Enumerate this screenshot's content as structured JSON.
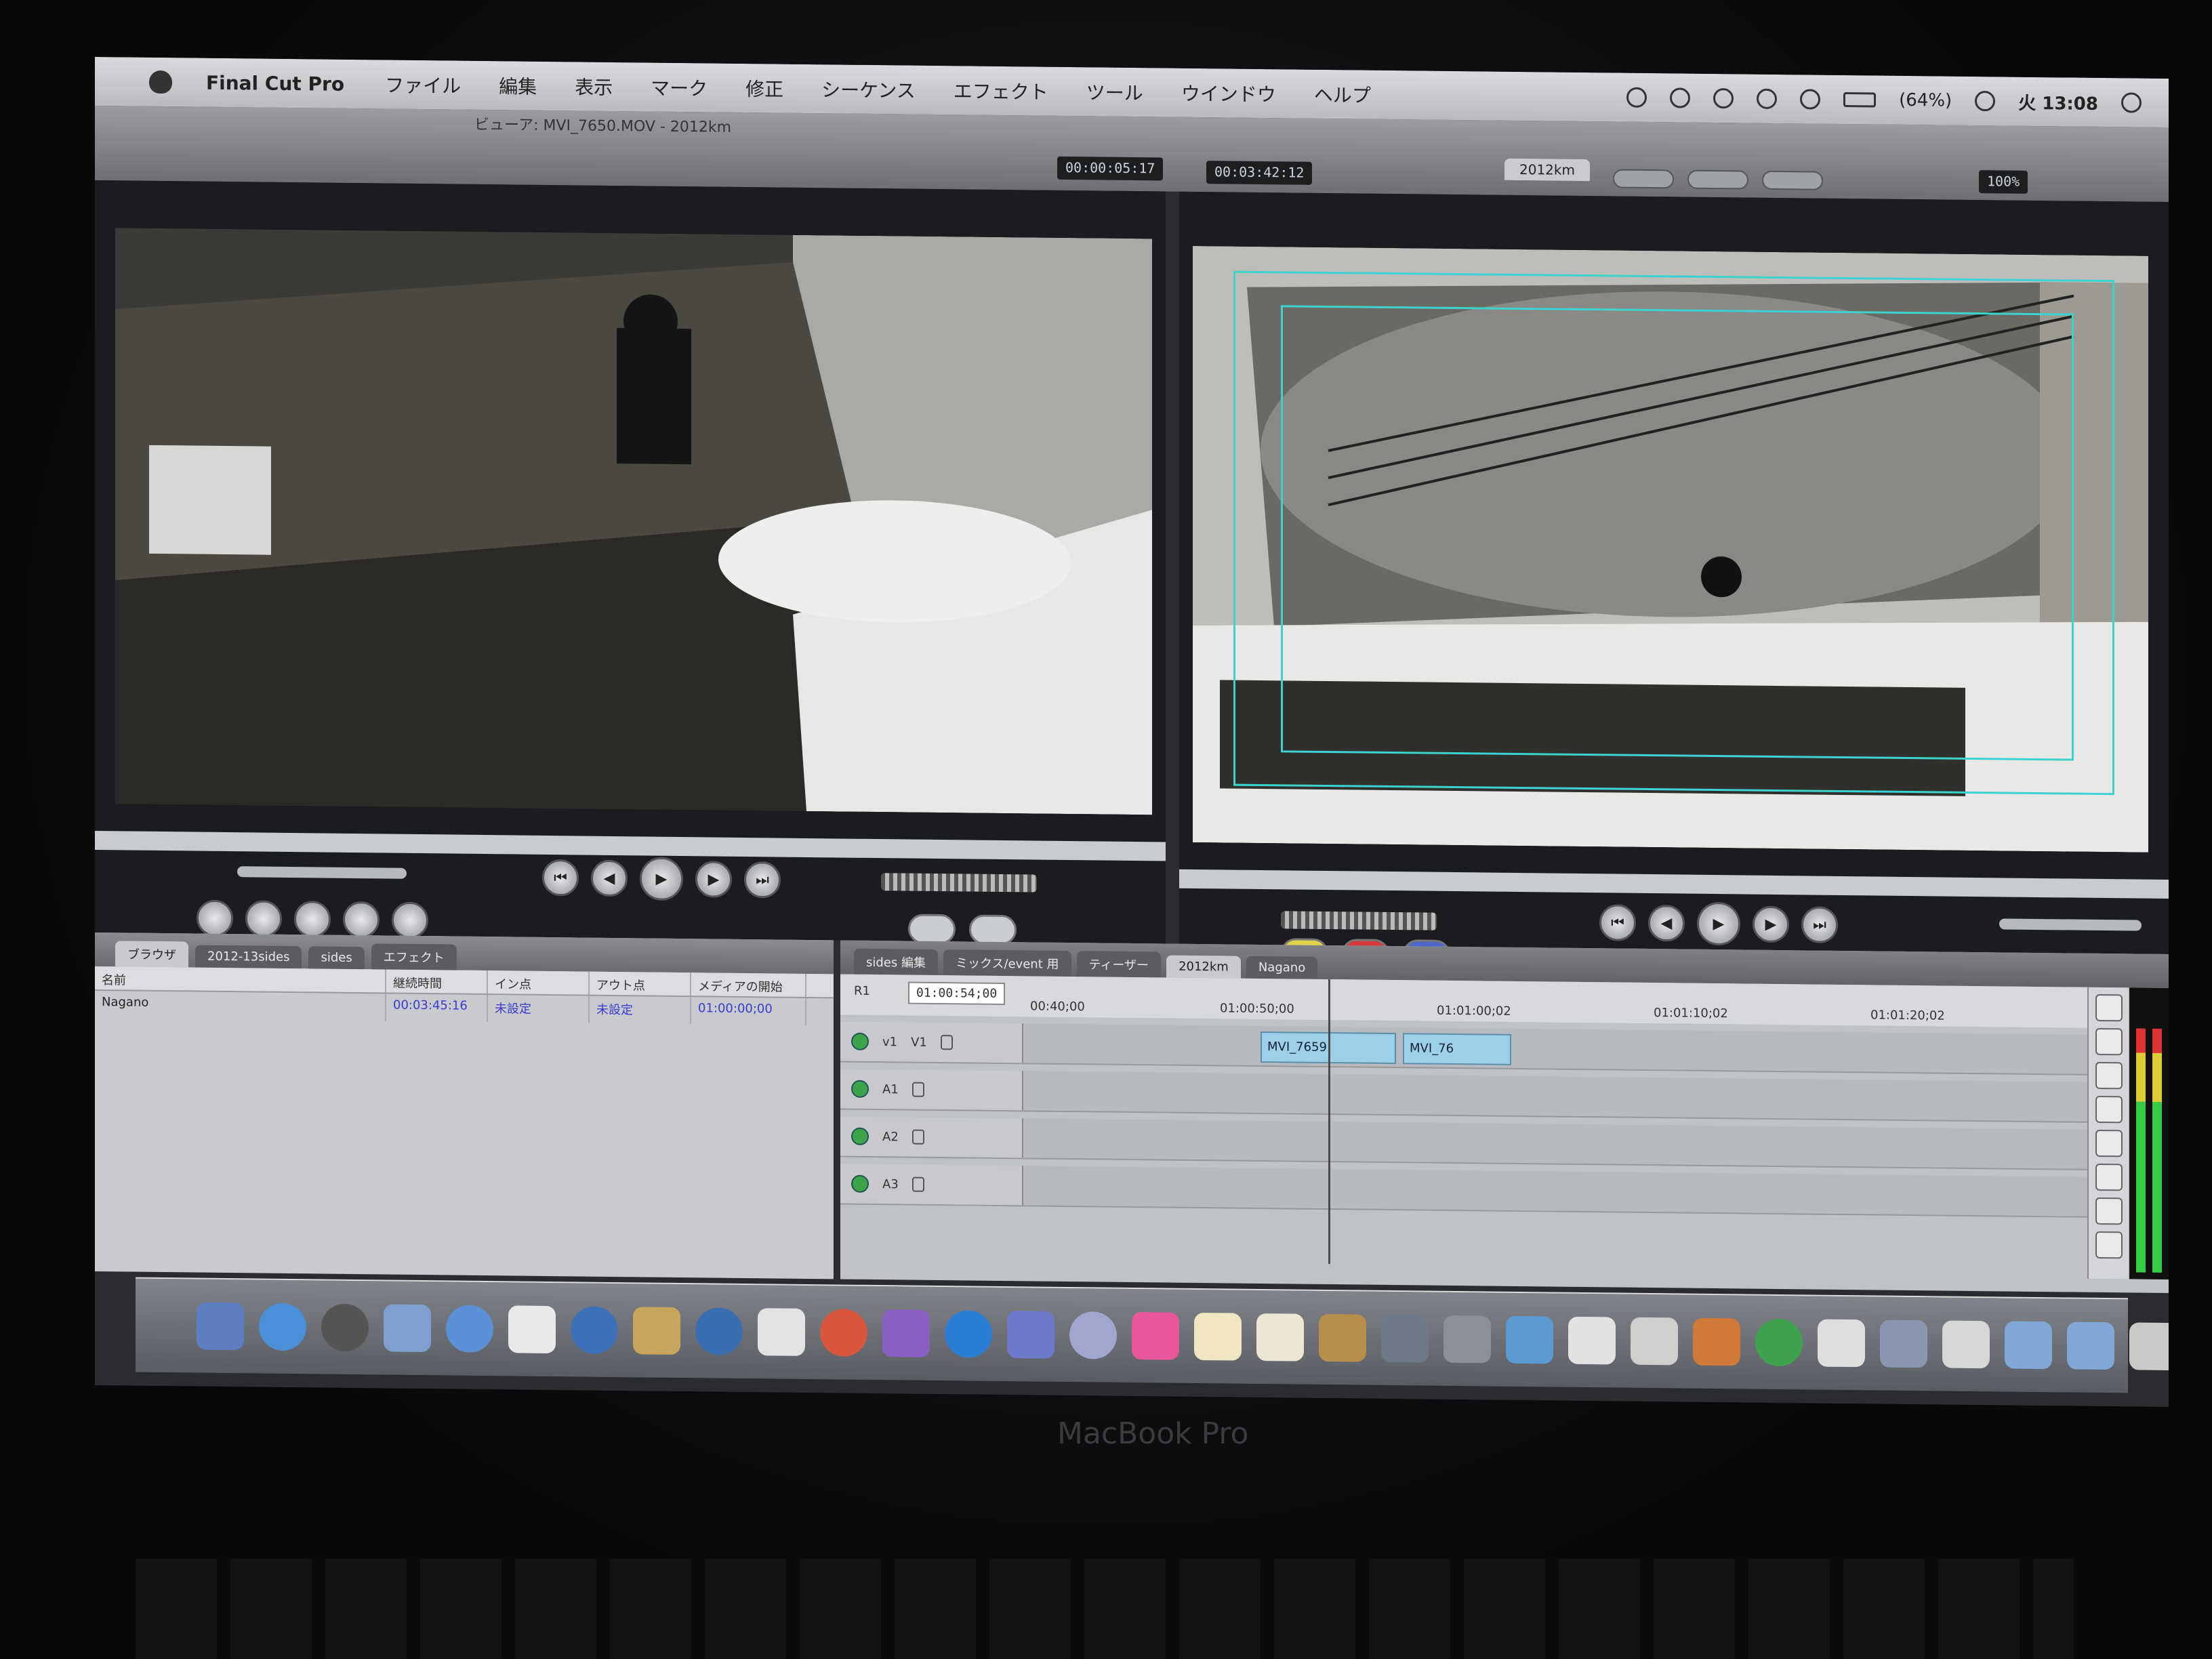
{
  "menubar": {
    "app_name": "Final Cut Pro",
    "items": [
      "ファイル",
      "編集",
      "表示",
      "マーク",
      "修正",
      "シーケンス",
      "エフェクト",
      "ツール",
      "ウインドウ",
      "ヘルプ"
    ],
    "battery": "(64%)",
    "clock": "火 13:08"
  },
  "window": {
    "title": "ビューア: MVI_7650.MOV - 2012km",
    "viewer_timecode": "00:00:05:17",
    "canvas_timecode": "00:03:42:12",
    "canvas_tab": "2012km",
    "canvas_zoom": "100%"
  },
  "browser": {
    "tabs": [
      "ブラウザ",
      "2012-13sides",
      "sides",
      "エフェクト"
    ],
    "columns": [
      "名前",
      "継続時間",
      "イン点",
      "アウト点",
      "メディアの開始"
    ],
    "rows": [
      {
        "name": "Nagano",
        "duration": "00:03:45:16",
        "in": "未設定",
        "out": "未設定",
        "media_start": "01:00:00;00"
      }
    ]
  },
  "timeline": {
    "tabs": [
      "sides 編集",
      "ミックス/event 用",
      "ティーザー",
      "2012km",
      "Nagano"
    ],
    "timecode": "01:00:54;00",
    "ruler_marks": [
      "00:40;00",
      "01:00:50;00",
      "01:01:00;02",
      "01:01:10;02",
      "01:01:20;02"
    ],
    "tracks": [
      {
        "id": "V1",
        "src": "v1"
      },
      {
        "id": "A1"
      },
      {
        "id": "A2"
      },
      {
        "id": "A3"
      }
    ],
    "clips": [
      "MVI_7659",
      "MVI_76"
    ],
    "sequence_label": "R1"
  },
  "laptop_brand": "MacBook Pro",
  "colors": {
    "overlay": "#3bd3cf",
    "clip": "#9ecfe8",
    "track_visible": "#3da44b"
  }
}
